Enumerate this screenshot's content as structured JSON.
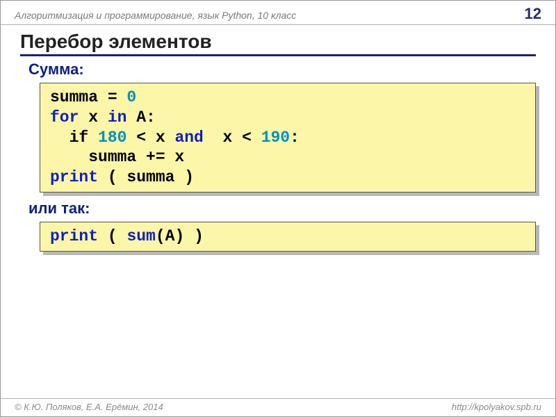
{
  "header": {
    "course": "Алгоритмизация и программирование, язык Python, 10 класс",
    "page": "12"
  },
  "title": "Перебор элементов",
  "section1_label": "Сумма:",
  "code1": {
    "l1a": "summa = ",
    "l1n": "0",
    "l2a": "for",
    "l2b": " x ",
    "l2c": "in",
    "l2d": " A:",
    "l3a": "  if ",
    "l3n1": "180",
    "l3b": " < x ",
    "l3c": "and",
    "l3d": "  x < ",
    "l3n2": "190",
    "l3e": ":",
    "l4": "    summa += x",
    "l5a": "print",
    "l5b": " ( summa )"
  },
  "section2_label": "или так:",
  "code2": {
    "l1a": "print",
    "l1b": " ( ",
    "l1c": "sum",
    "l1d": "(A) )"
  },
  "footer": {
    "authors": "© К.Ю. Поляков, Е.А. Ерёмин, 2014",
    "url": "http://kpolyakov.spb.ru"
  }
}
